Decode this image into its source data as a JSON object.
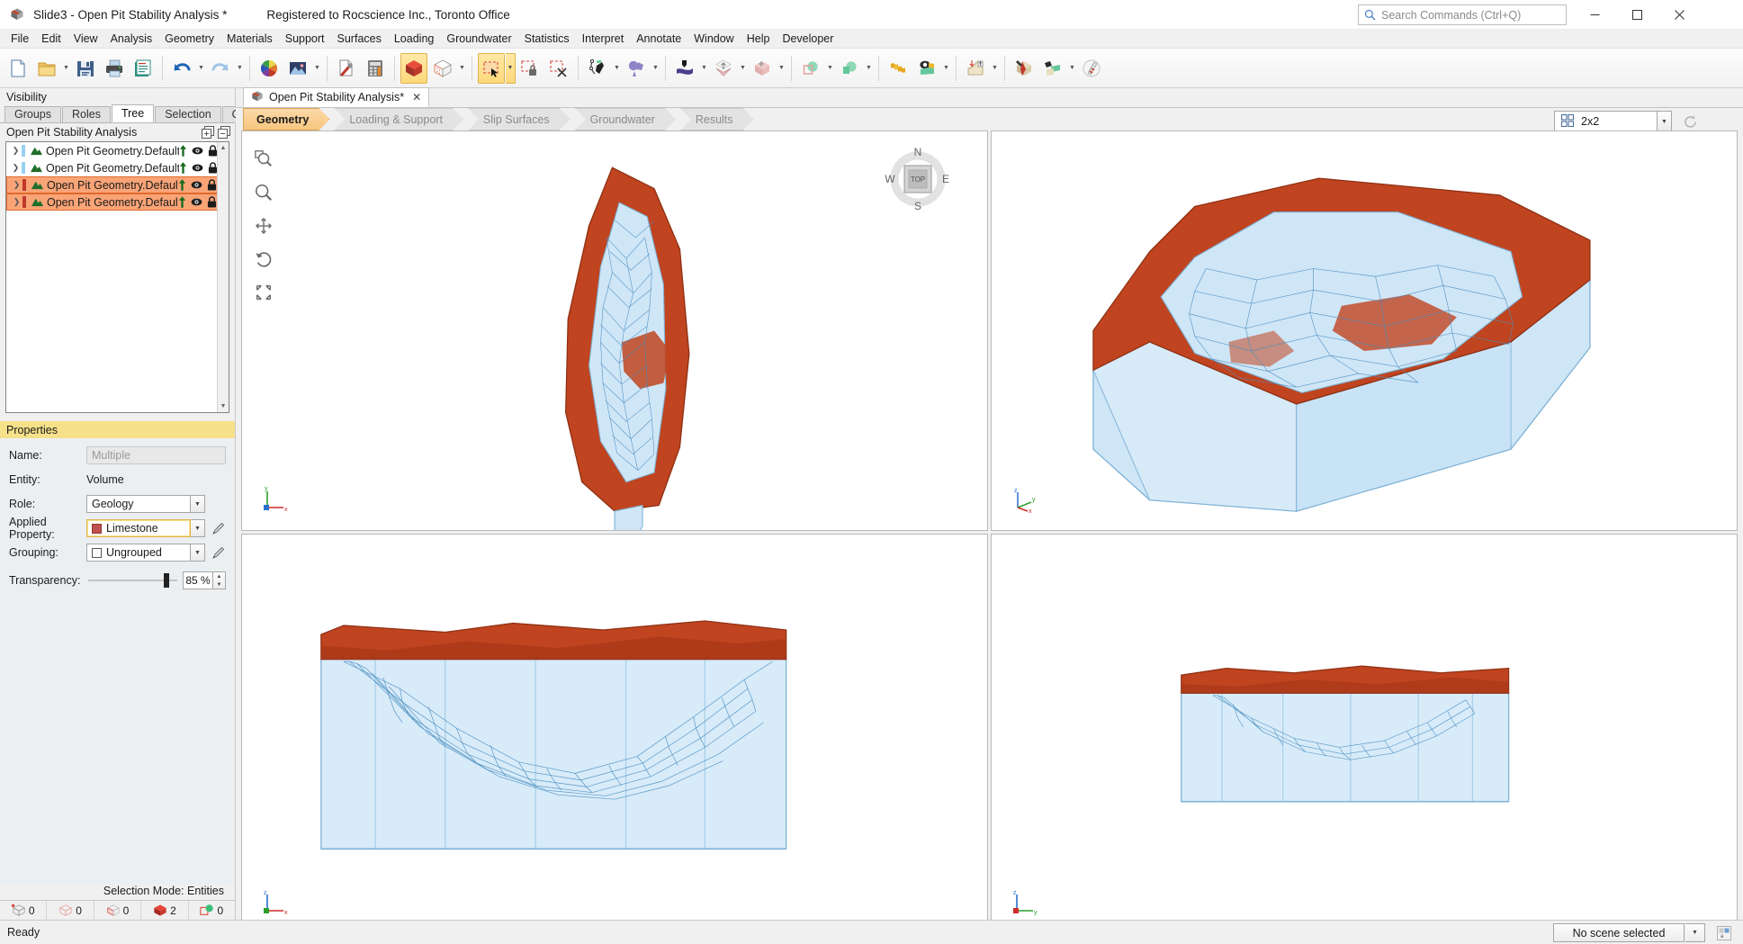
{
  "window": {
    "title": "Slide3 - Open Pit Stability Analysis *",
    "registration": "Registered to Rocscience Inc., Toronto Office",
    "app_icon": "slide3-cube-icon",
    "minimize_icon": "minimize-icon",
    "maximize_icon": "maximize-icon",
    "close_icon": "close-icon"
  },
  "search": {
    "placeholder": "Search Commands (Ctrl+Q)",
    "icon": "search-icon"
  },
  "menubar": {
    "items": [
      {
        "label": "File"
      },
      {
        "label": "Edit"
      },
      {
        "label": "View"
      },
      {
        "label": "Analysis"
      },
      {
        "label": "Geometry"
      },
      {
        "label": "Materials"
      },
      {
        "label": "Support"
      },
      {
        "label": "Surfaces"
      },
      {
        "label": "Loading"
      },
      {
        "label": "Groundwater"
      },
      {
        "label": "Statistics"
      },
      {
        "label": "Interpret"
      },
      {
        "label": "Annotate"
      },
      {
        "label": "Window"
      },
      {
        "label": "Help"
      },
      {
        "label": "Developer"
      }
    ]
  },
  "toolbar": {
    "groups": [
      [
        "new-file-icon",
        "open-folder-icon",
        "save-icon",
        "print-icon",
        "report-icon"
      ],
      [
        "undo-icon",
        "redo-icon"
      ],
      [
        "color-wheel-icon",
        "image-icon"
      ],
      [
        "settings-tool-icon",
        "calculator-icon"
      ],
      [
        "solid-cube-icon",
        "wireframe-cube-icon"
      ],
      [
        "select-rectangle-icon",
        "select-locked-icon",
        "select-clear-icon"
      ],
      [
        "polyline-draw-icon",
        "boolean-shapes-icon"
      ],
      [
        "extrude-surface-icon",
        "import-solid-icon",
        "move-solid-icon"
      ],
      [
        "intersect-icon",
        "union-icon"
      ],
      [
        "layers-icon",
        "view-solids-icon"
      ],
      [
        "slope-limits-icon"
      ],
      [
        "material-edit-icon",
        "material-assign-icon",
        "annotate-pen-icon"
      ]
    ]
  },
  "visibility_dock": {
    "title": "Visibility",
    "tabs": [
      {
        "label": "Groups",
        "active": false
      },
      {
        "label": "Roles",
        "active": false
      },
      {
        "label": "Tree",
        "active": true
      },
      {
        "label": "Selection",
        "active": false
      },
      {
        "label": "Query",
        "active": false
      }
    ],
    "tree_header": "Open Pit Stability Analysis",
    "expand_all_icon": "expand-all-icon",
    "collapse_all_icon": "collapse-all-icon",
    "rows": [
      {
        "label": "Open Pit Geometry.Default.Mesh_rem",
        "selected": false,
        "color": "#9ad1f0",
        "icons": [
          "pin-icon",
          "eye-icon",
          "lock-icon"
        ]
      },
      {
        "label": "Open Pit Geometry.Default.Mesh_rem",
        "selected": false,
        "color": "#9ad1f0",
        "icons": [
          "pin-icon",
          "eye-icon",
          "lock-icon"
        ]
      },
      {
        "label": "Open Pit Geometry.Default.Mesh_rem",
        "selected": true,
        "color": "#c0392b",
        "icons": [
          "pin-icon",
          "eye-icon",
          "lock-icon"
        ]
      },
      {
        "label": "Open Pit Geometry.Default.Mesh_rem",
        "selected": true,
        "color": "#c0392b",
        "icons": [
          "pin-icon",
          "eye-icon",
          "lock-icon"
        ]
      }
    ]
  },
  "properties": {
    "title": "Properties",
    "name_label": "Name:",
    "name_value": "Multiple",
    "entity_label": "Entity:",
    "entity_value": "Volume",
    "role_label": "Role:",
    "role_value": "Geology",
    "applied_property_label": "Applied Property:",
    "applied_property_value": "Limestone",
    "applied_property_color": "#c0504d",
    "grouping_label": "Grouping:",
    "grouping_value": "Ungrouped",
    "transparency_label": "Transparency:",
    "transparency_value": "85 %",
    "transparency_percent": 85,
    "edit_icon": "pencil-edit-icon"
  },
  "selection_status": {
    "mode_text": "Selection Mode: Entities",
    "counts": [
      {
        "icon": "vertex-count-icon",
        "value": "0"
      },
      {
        "icon": "edge-count-icon",
        "value": "0"
      },
      {
        "icon": "face-count-icon",
        "value": "0"
      },
      {
        "icon": "volume-count-icon",
        "value": "2"
      },
      {
        "icon": "group-count-icon",
        "value": "0"
      }
    ]
  },
  "document_tab": {
    "label": "Open Pit Stability Analysis*",
    "icon": "document-cube-icon",
    "close_icon": "close-tab-icon"
  },
  "workflow": {
    "steps": [
      {
        "label": "Geometry",
        "active": true
      },
      {
        "label": "Loading & Support",
        "active": false
      },
      {
        "label": "Slip Surfaces",
        "active": false
      },
      {
        "label": "Groundwater",
        "active": false
      },
      {
        "label": "Results",
        "active": false
      }
    ]
  },
  "layout": {
    "value": "2x2",
    "grid_icon": "grid-2x2-icon",
    "dropdown_icon": "chevron-down-icon",
    "refresh_icon": "refresh-icon"
  },
  "viewport_tools": {
    "items": [
      {
        "icon": "zoom-window-icon"
      },
      {
        "icon": "zoom-icon"
      },
      {
        "icon": "pan-icon"
      },
      {
        "icon": "rotate-icon"
      },
      {
        "icon": "zoom-all-icon"
      }
    ]
  },
  "compass": {
    "north": "N",
    "south": "S",
    "east": "E",
    "west": "W",
    "face": "TOP"
  },
  "views": [
    {
      "name": "top-view",
      "axes": [
        "y",
        "x"
      ],
      "axis_corner_icon": "axis-triad-icon"
    },
    {
      "name": "iso-view",
      "axes": [
        "z",
        "y",
        "x"
      ],
      "axis_corner_icon": "axis-triad-icon"
    },
    {
      "name": "front-view",
      "axes": [
        "z",
        "x"
      ],
      "axis_corner_icon": "axis-triad-icon"
    },
    {
      "name": "side-view",
      "axes": [
        "z",
        "y"
      ],
      "axis_corner_icon": "axis-triad-icon"
    }
  ],
  "statusbar": {
    "ready_text": "Ready",
    "scene_value": "No scene selected",
    "scene_dropdown_icon": "chevron-down-icon",
    "scene_extra_icon": "scene-properties-icon"
  },
  "colors": {
    "accent_orange": "#f9a477",
    "highlight_yellow": "#f6e08a",
    "rock_orange": "#c0441f",
    "water_blue": "#cfe6f7",
    "mesh_blue": "#4a8fc0"
  }
}
